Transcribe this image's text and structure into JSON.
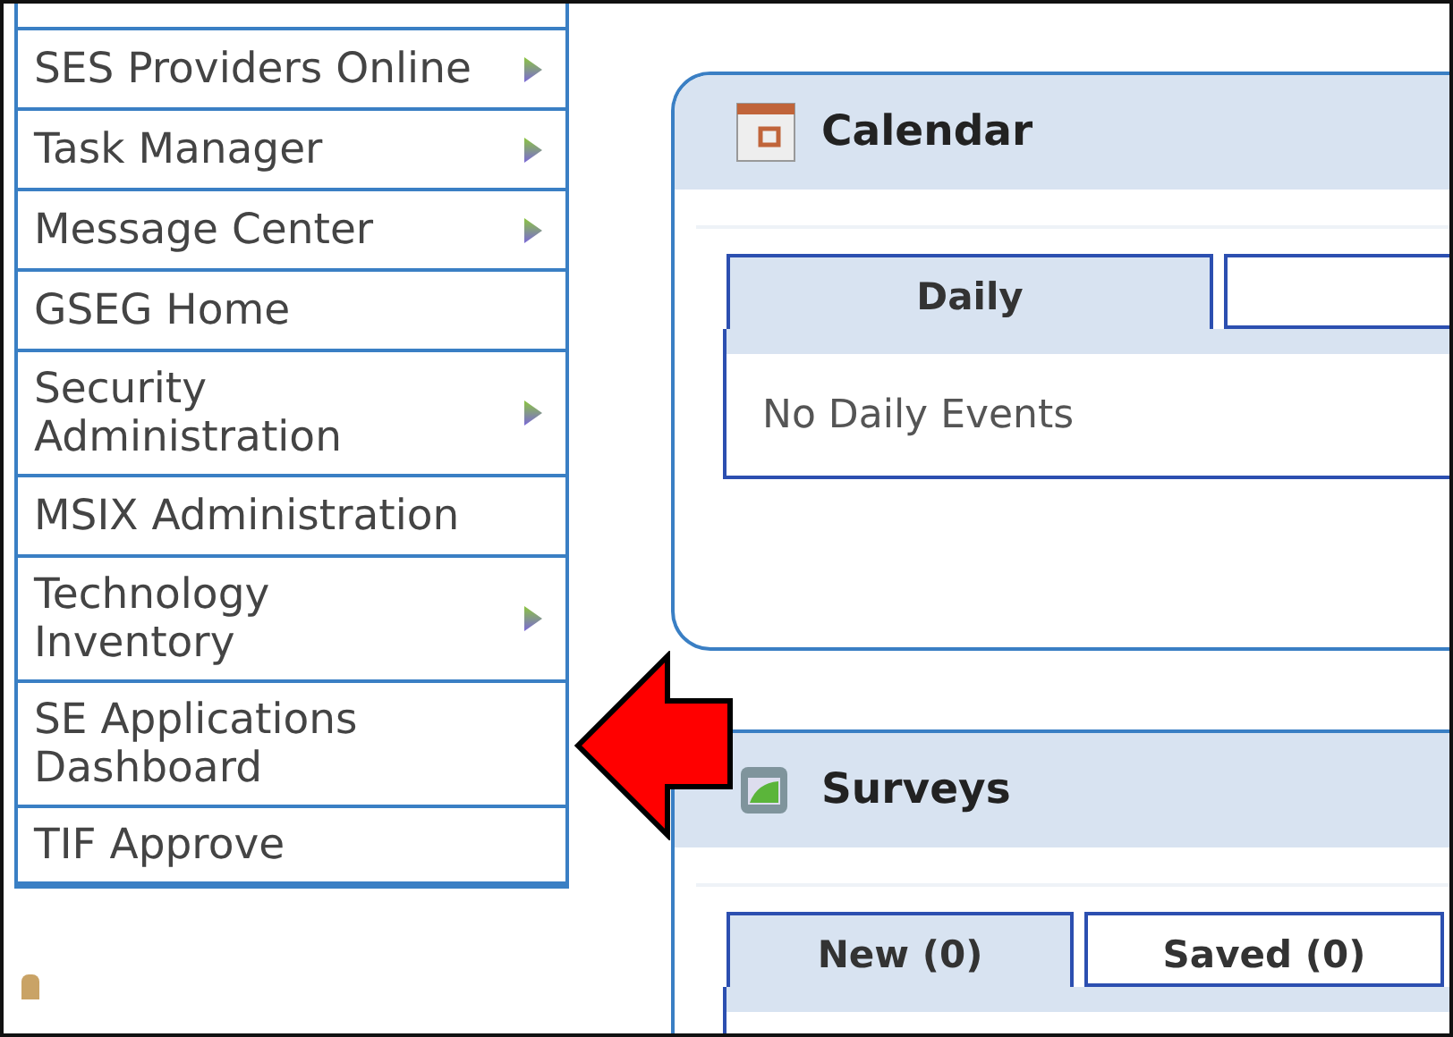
{
  "sidebar": {
    "items": [
      {
        "label": "SES Providers Online",
        "has_submenu": true
      },
      {
        "label": "Task Manager",
        "has_submenu": true
      },
      {
        "label": "Message Center",
        "has_submenu": true
      },
      {
        "label": "GSEG Home",
        "has_submenu": false
      },
      {
        "label": "Security Administration",
        "has_submenu": true
      },
      {
        "label": "MSIX Administration",
        "has_submenu": false
      },
      {
        "label": "Technology Inventory",
        "has_submenu": true
      },
      {
        "label": "SE Applications Dashboard",
        "has_submenu": false
      },
      {
        "label": "TIF Approve",
        "has_submenu": false
      }
    ]
  },
  "panels": [
    {
      "kind": "calendar",
      "title": "Calendar",
      "tabs": [
        {
          "label": "Daily",
          "selected": true
        },
        {
          "selected": false
        }
      ],
      "message": "No Daily Events"
    },
    {
      "kind": "surveys",
      "title": "Surveys",
      "tabs": [
        {
          "label": "New (0)",
          "selected": true
        },
        {
          "label": "Saved (0)",
          "selected": false
        }
      ]
    }
  ],
  "annotation": {
    "kind": "arrow",
    "color": "#ff0000"
  }
}
